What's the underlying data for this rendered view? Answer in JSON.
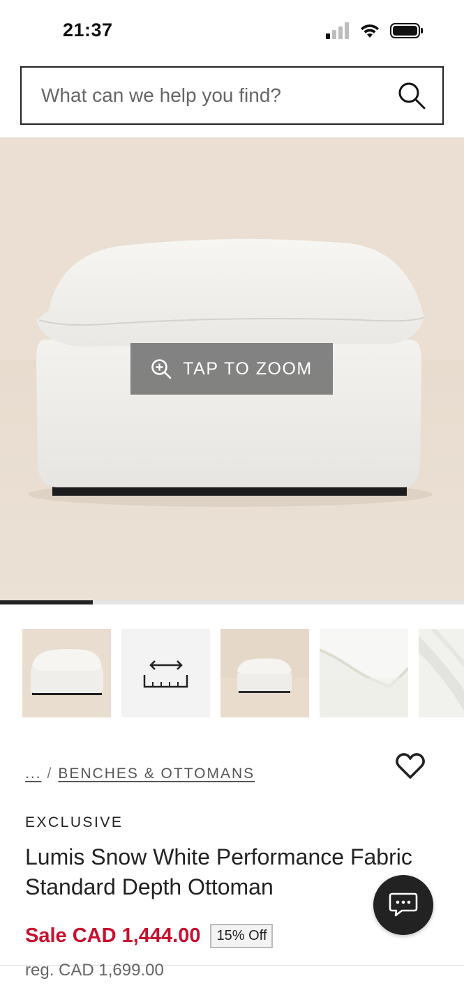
{
  "status_bar": {
    "time": "21:37",
    "icons": [
      "cellular-signal-icon",
      "wifi-icon",
      "battery-icon"
    ]
  },
  "search": {
    "placeholder": "What can we help you find?",
    "icon": "search-icon"
  },
  "hero": {
    "zoom_label": "TAP TO ZOOM",
    "zoom_icon": "zoom-in-icon",
    "gallery_progress": 0.2
  },
  "thumbnails": [
    {
      "kind": "photo",
      "icon": "ottoman-front-photo",
      "active": true
    },
    {
      "kind": "dimensions",
      "icon": "ruler-dimensions-icon",
      "active": false
    },
    {
      "kind": "photo",
      "icon": "ottoman-room-photo",
      "active": false
    },
    {
      "kind": "photo",
      "icon": "cushion-closeup-photo",
      "active": false
    },
    {
      "kind": "photo",
      "icon": "fabric-closeup-photo",
      "active": false
    }
  ],
  "breadcrumb": {
    "ellipsis": "...",
    "separator": "/",
    "category": "BENCHES & OTTOMANS"
  },
  "product": {
    "badge": "EXCLUSIVE",
    "title": "Lumis Snow White Performance Fabric Standard Depth Ottoman",
    "sale_price": "Sale CAD 1,444.00",
    "discount": "15% Off",
    "regular_price": "reg. CAD 1,699.00"
  },
  "colors": {
    "sale_red": "#c8102e",
    "text": "#222222",
    "hero_bg": "#eadfd2"
  }
}
